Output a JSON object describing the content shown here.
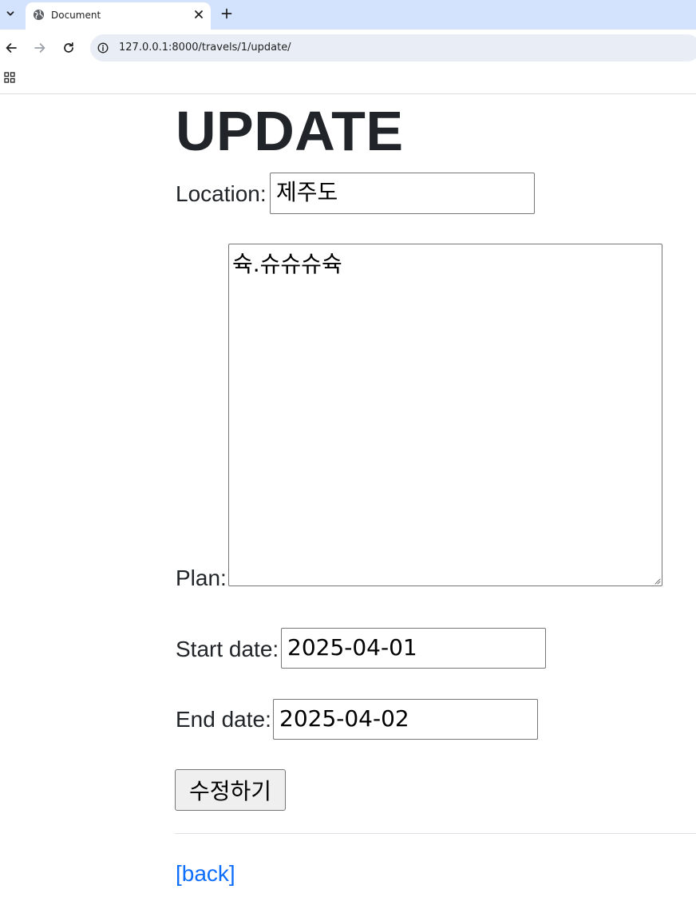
{
  "browser": {
    "tab_title": "Document",
    "url": "127.0.0.1:8000/travels/1/update/"
  },
  "page": {
    "title": "UPDATE",
    "location_label": "Location:",
    "location_value": "제주도",
    "plan_label": "Plan:",
    "plan_value": "슉.슈슈슈슉",
    "start_label": "Start date:",
    "start_value": "2025-04-01",
    "end_label": "End date:",
    "end_value": "2025-04-02",
    "submit_label": "수정하기",
    "back_label": "[back]"
  },
  "colors": {
    "tabstrip": "#d3e3fd",
    "omnibox": "#e9eef6",
    "link": "#0d6efd",
    "text": "#212529"
  }
}
